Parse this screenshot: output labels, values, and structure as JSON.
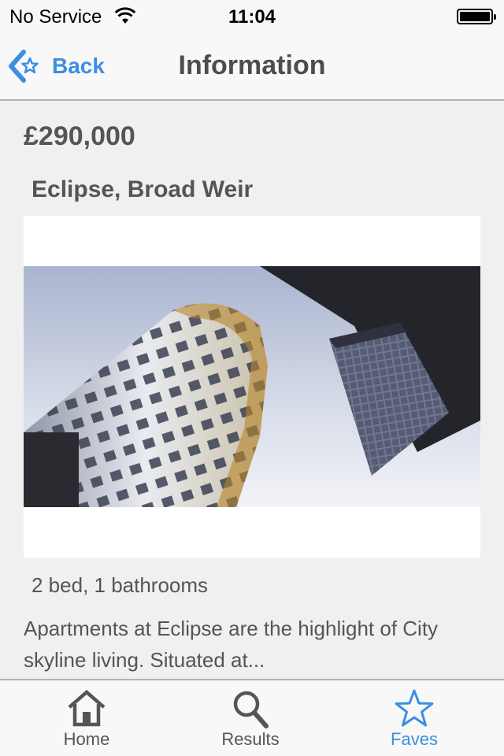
{
  "status_bar": {
    "carrier": "No Service",
    "time": "11:04",
    "wifi_icon": "wifi-icon",
    "battery_icon": "battery-icon"
  },
  "nav": {
    "back_label": "Back",
    "back_icon": "back-star-chevron-icon",
    "title": "Information"
  },
  "listing": {
    "price": "£290,000",
    "address": "Eclipse, Broad Weir",
    "rooms": "2 bed, 1 bathrooms",
    "description": "Apartments at Eclipse are the highlight of City skyline living. Situated at..."
  },
  "tabs": [
    {
      "label": "Home",
      "icon": "home-icon",
      "active": false
    },
    {
      "label": "Results",
      "icon": "search-icon",
      "active": false
    },
    {
      "label": "Faves",
      "icon": "star-icon",
      "active": true
    }
  ],
  "colors": {
    "accent": "#3c8ee2",
    "text": "#555555",
    "background": "#f0f0f0",
    "bar": "#f8f8f8"
  }
}
